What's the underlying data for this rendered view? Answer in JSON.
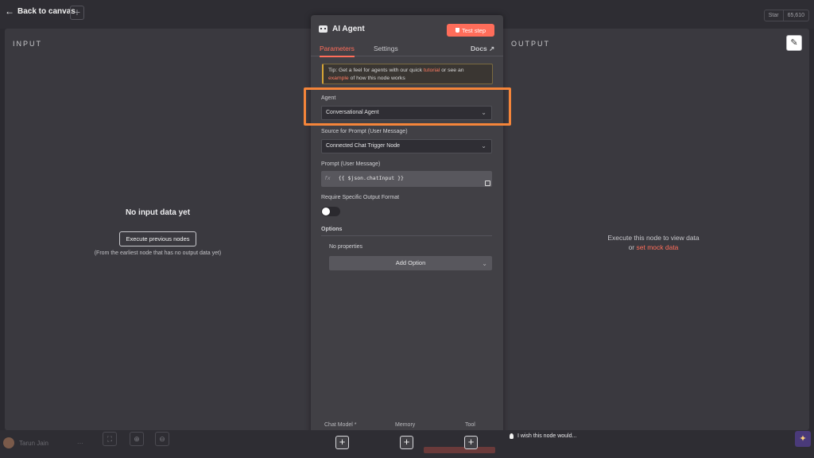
{
  "topbar": {
    "back_label": "Back to canvas",
    "github": {
      "star_label": "Star",
      "count": "65,610"
    }
  },
  "input_panel": {
    "title": "INPUT",
    "empty_title": "No input data yet",
    "execute_button": "Execute previous nodes",
    "hint": "(From the earliest node that has no output data yet)"
  },
  "output_panel": {
    "title": "OUTPUT",
    "message": "Execute this node to view data",
    "or": "or",
    "mock_link": "set mock data"
  },
  "node": {
    "title": "AI Agent",
    "test_button": "Test step",
    "tabs": [
      {
        "label": "Parameters",
        "active": true
      },
      {
        "label": "Settings",
        "active": false
      }
    ],
    "docs_label": "Docs",
    "tip": {
      "prefix": "Tip: Get a feel for agents with our quick",
      "link1": "tutorial",
      "mid": "or see an",
      "link2": "example",
      "suffix": "of how this node works"
    },
    "agent": {
      "label": "Agent",
      "value": "Conversational Agent"
    },
    "source": {
      "label": "Source for Prompt (User Message)",
      "value": "Connected Chat Trigger Node"
    },
    "prompt": {
      "label": "Prompt (User Message)",
      "fx": "fx",
      "value": "{{ $json.chatInput }}"
    },
    "output_format": {
      "label": "Require Specific Output Format",
      "enabled": false
    },
    "options": {
      "label": "Options",
      "empty": "No properties",
      "add_button": "Add Option"
    },
    "connectors": [
      {
        "label": "Chat Model *"
      },
      {
        "label": "Memory"
      },
      {
        "label": "Tool"
      }
    ],
    "plus": "+"
  },
  "bottom": {
    "user_name": "Tarun Jain",
    "user_menu": "···",
    "wish_text": "I wish this node would..."
  },
  "colors": {
    "accent": "#ff6d5a",
    "highlight": "#f5853a"
  }
}
